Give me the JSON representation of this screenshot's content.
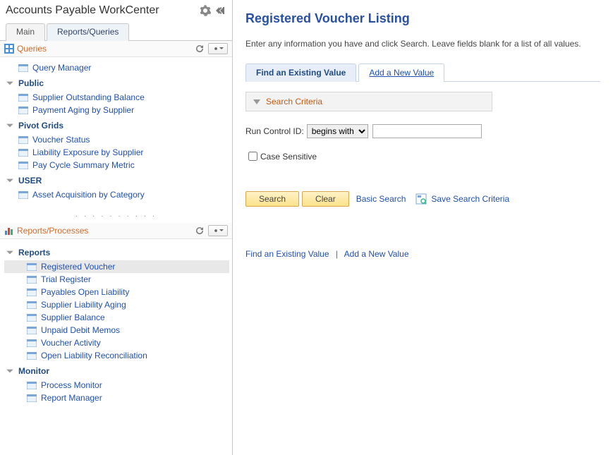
{
  "workcenter": {
    "title": "Accounts Payable WorkCenter",
    "tabs": {
      "main": "Main",
      "reports": "Reports/Queries"
    }
  },
  "queries_section": {
    "title": "Queries",
    "query_manager": "Query Manager",
    "groups": {
      "public": {
        "label": "Public",
        "items": [
          "Supplier Outstanding Balance",
          "Payment Aging by Supplier"
        ]
      },
      "pivot": {
        "label": "Pivot Grids",
        "items": [
          "Voucher Status",
          "Liability Exposure by Supplier",
          "Pay Cycle Summary Metric"
        ]
      },
      "user": {
        "label": "USER",
        "items": [
          "Asset Acquisition by Category"
        ]
      }
    }
  },
  "reports_section": {
    "title": "Reports/Processes",
    "groups": {
      "reports": {
        "label": "Reports",
        "items": [
          "Registered Voucher",
          "Trial Register",
          "Payables Open Liability",
          "Supplier Liability Aging",
          "Supplier Balance",
          "Unpaid Debit Memos",
          "Voucher Activity",
          "Open Liability Reconciliation"
        ]
      },
      "monitor": {
        "label": "Monitor",
        "items": [
          "Process Monitor",
          "Report Manager"
        ]
      }
    }
  },
  "page": {
    "title": "Registered Voucher Listing",
    "instruction": "Enter any information you have and click Search. Leave fields blank for a list of all values.",
    "find_tab": "Find an Existing Value",
    "add_tab": "Add a New Value",
    "criteria_title": "Search Criteria",
    "run_control_label": "Run Control ID:",
    "operator": "begins with",
    "run_control_value": "",
    "case_sensitive_label": "Case Sensitive",
    "search_btn": "Search",
    "clear_btn": "Clear",
    "basic_search": "Basic Search",
    "save_search": "Save Search Criteria",
    "bottom_find": "Find an Existing Value",
    "bottom_add": "Add a New Value"
  }
}
